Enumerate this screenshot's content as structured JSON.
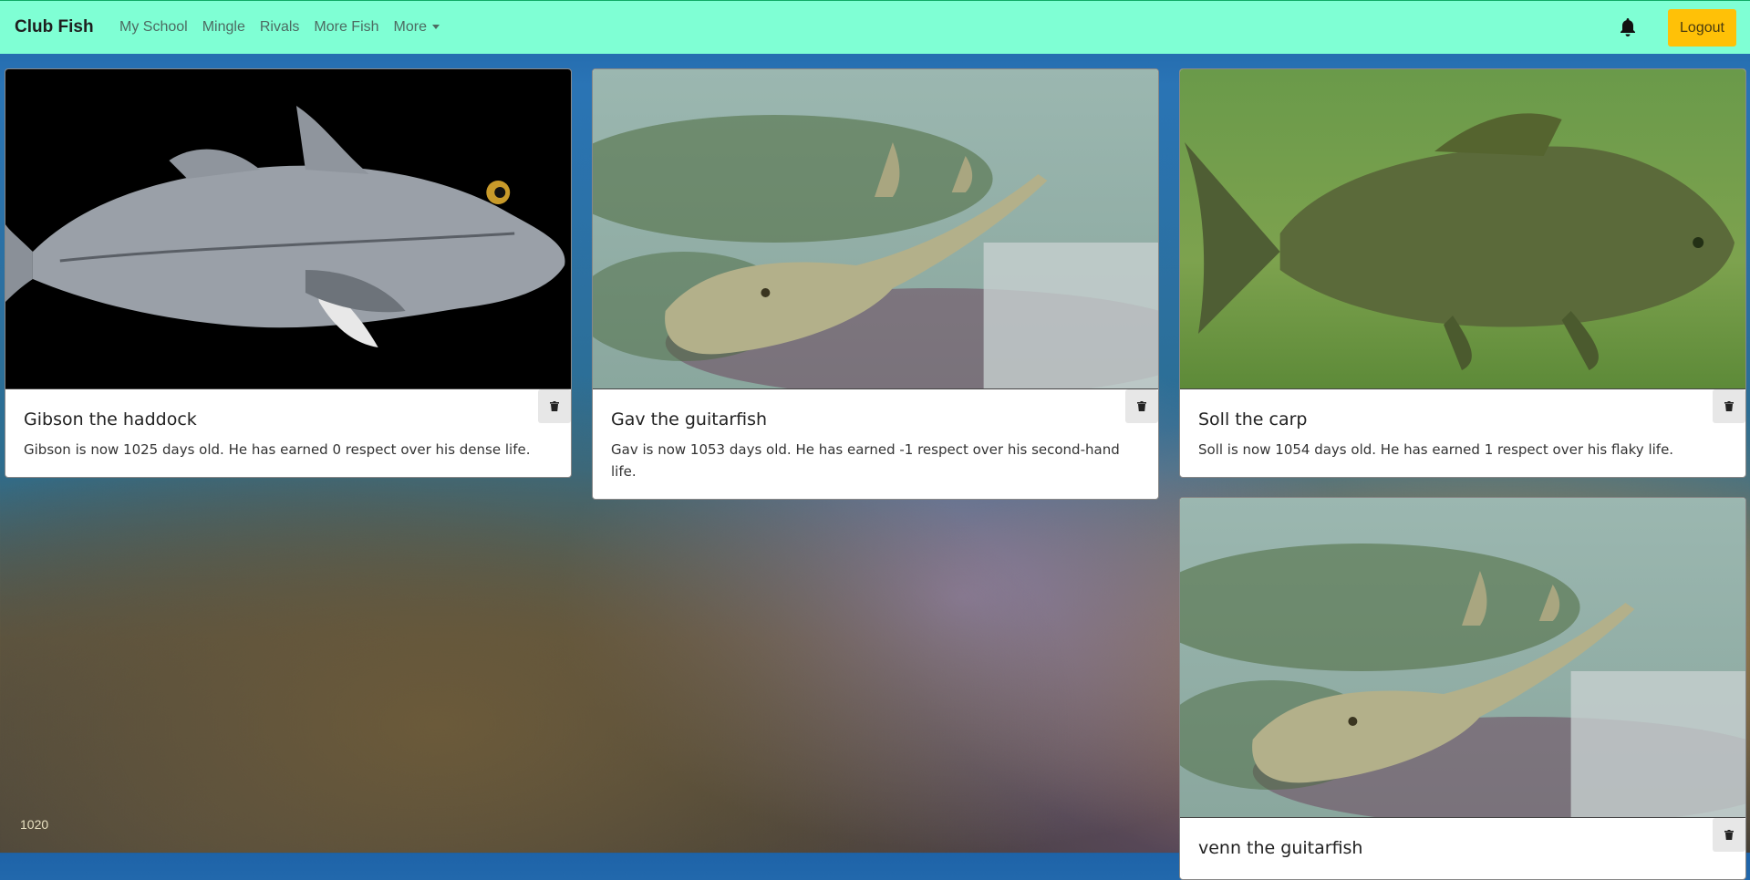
{
  "navbar": {
    "brand": "Club Fish",
    "links": [
      {
        "label": "My School"
      },
      {
        "label": "Mingle"
      },
      {
        "label": "Rivals"
      },
      {
        "label": "More Fish"
      },
      {
        "label": "More"
      }
    ],
    "logout_label": "Logout",
    "background": "#7fffd4",
    "logout_color": "#ffc107"
  },
  "cards": [
    {
      "title": "Gibson the haddock",
      "text": "Gibson is now 1025 days old. He has earned 0 respect over his dense life.",
      "image": "haddock on black background"
    },
    {
      "title": "Gav the guitarfish",
      "text": "Gav is now 1053 days old. He has earned -1 respect over his second-hand life.",
      "image": "guitarfish on seagrass"
    },
    {
      "title": "Soll the carp",
      "text": "Soll is now 1054 days old. He has earned 1 respect over his flaky life.",
      "image": "carp in green water"
    },
    {
      "title": "venn the guitarfish",
      "text": "",
      "image": "guitarfish on seagrass"
    }
  ],
  "footer_number": "1020",
  "icons": {
    "bell": "bell-icon",
    "delete": "trash-icon"
  }
}
